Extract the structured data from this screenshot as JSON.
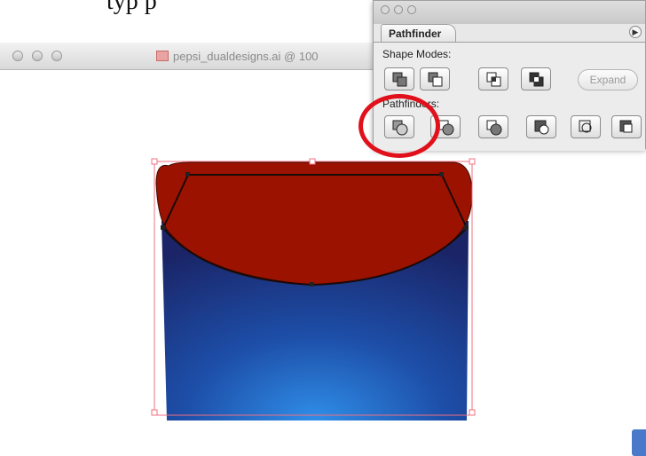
{
  "caption": {
    "text": "typ p"
  },
  "document": {
    "title": "pepsi_dualdesigns.ai @ 100",
    "icon": "ai-document-icon"
  },
  "pathfinder": {
    "tab_label": "Pathfinder",
    "shape_modes_label": "Shape Modes:",
    "pathfinders_label": "Pathfinders:",
    "expand_label": "Expand",
    "shape_mode_buttons": [
      "add-to-shape-area",
      "subtract-from-shape-area",
      "intersect-shape-areas",
      "exclude-overlapping-shape-areas"
    ],
    "pathfinder_buttons": [
      "divide",
      "trim",
      "merge",
      "crop",
      "outline",
      "minus-back"
    ]
  },
  "colors": {
    "highlight_circle": "#e0111b",
    "can_red": "#9c1200",
    "can_blue_light": "#2f8ee8",
    "can_blue_dark": "#1a2466",
    "selection": "#f07080"
  }
}
